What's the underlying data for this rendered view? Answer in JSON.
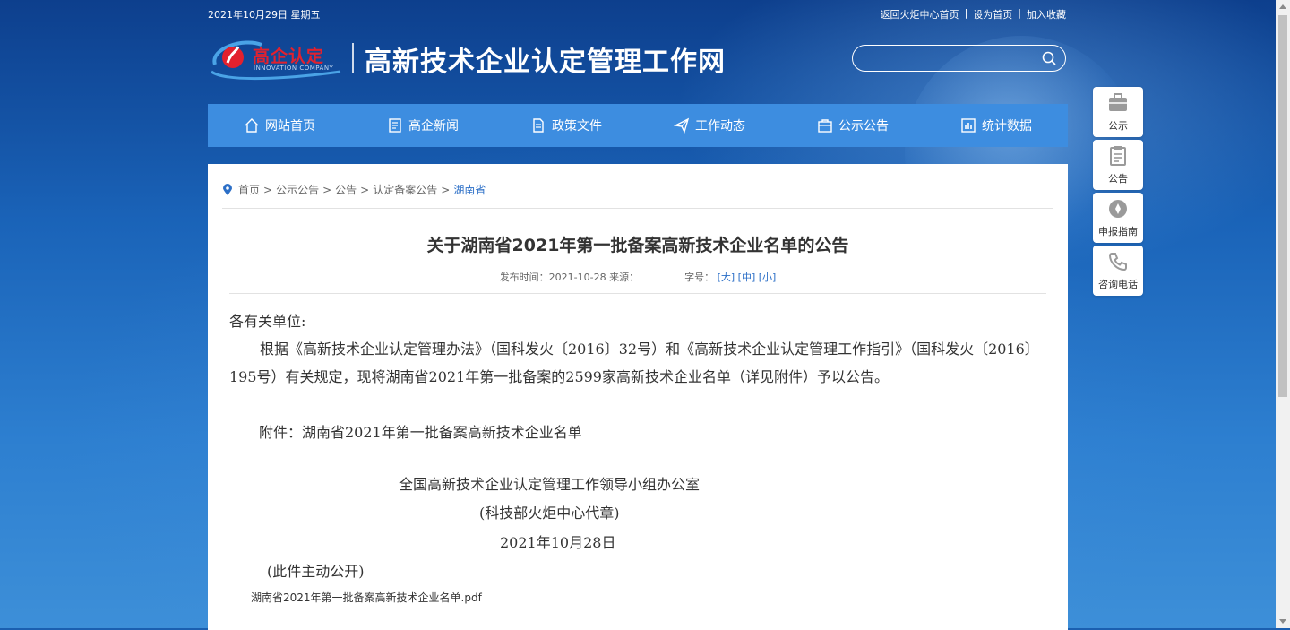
{
  "topbar": {
    "date": "2021年10月29日 星期五",
    "links": [
      "返回火炬中心首页",
      "设为首页",
      "加入收藏"
    ],
    "separator": "|"
  },
  "logo": {
    "brand_cn": "高企认定",
    "brand_en": "INNOVATION COMPANY",
    "site_title": "高新技术企业认定管理工作网"
  },
  "search": {
    "placeholder": "",
    "icon": "search-icon"
  },
  "nav": {
    "items": [
      {
        "label": "网站首页",
        "icon": "home-icon"
      },
      {
        "label": "高企新闻",
        "icon": "news-icon"
      },
      {
        "label": "政策文件",
        "icon": "document-icon"
      },
      {
        "label": "工作动态",
        "icon": "send-icon"
      },
      {
        "label": "公示公告",
        "icon": "notice-icon"
      },
      {
        "label": "统计数据",
        "icon": "chart-icon"
      }
    ]
  },
  "breadcrumb": {
    "items": [
      "首页",
      "公示公告",
      "公告",
      "认定备案公告",
      "湖南省"
    ],
    "separator": ">"
  },
  "article": {
    "title": "关于湖南省2021年第一批备案高新技术企业名单的公告",
    "meta": {
      "published_label": "发布时间：",
      "published_date": "2021-10-28",
      "source_label": "来源：",
      "font_label": "字号：",
      "font_large": "[大]",
      "font_medium": "[中]",
      "font_small": "[小]"
    },
    "salutation": "各有关单位:",
    "paragraph": "根据《高新技术企业认定管理办法》（国科发火〔2016〕32号）和《高新技术企业认定管理工作指引》（国科发火〔2016〕195号）有关规定，现将湖南省2021年第一批备案的2599家高新技术企业名单（详见附件）予以公告。",
    "attachment": "附件：湖南省2021年第一批备案高新技术企业名单",
    "signature_org": "全国高新技术企业认定管理工作领导小组办公室",
    "signature_stamp": "(科技部火炬中心代章)",
    "signature_date": "2021年10月28日",
    "disclosure": "(此件主动公开)",
    "file_link": "湖南省2021年第一批备案高新技术企业名单.pdf"
  },
  "sidebar": {
    "items": [
      {
        "label": "公示",
        "icon": "briefcase-icon"
      },
      {
        "label": "公告",
        "icon": "clipboard-icon"
      },
      {
        "label": "申报指南",
        "icon": "compass-icon"
      },
      {
        "label": "咨询电话",
        "icon": "phone-icon"
      }
    ]
  },
  "colors": {
    "nav_bg": "#3d8de0",
    "link": "#2c6fc7",
    "logo_red": "#e2212e"
  }
}
